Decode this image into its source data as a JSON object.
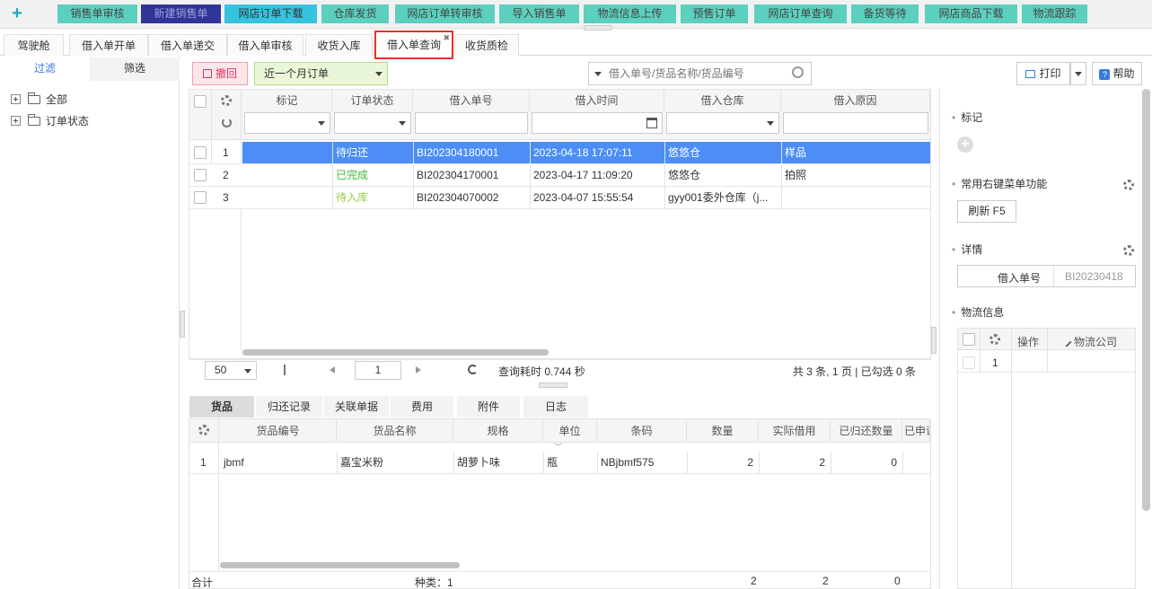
{
  "toolbar": {
    "add_icon": "plus-icon",
    "buttons": [
      {
        "label": "销售单审核",
        "style": "teal"
      },
      {
        "label": "新建销售单",
        "style": "navy"
      },
      {
        "label": "网店订单下载",
        "style": "cyan"
      },
      {
        "label": "仓库发货",
        "style": "teal"
      },
      {
        "label": "网店订单转审核",
        "style": "teal"
      },
      {
        "label": "导入销售单",
        "style": "teal"
      },
      {
        "label": "物流信息上传",
        "style": "teal"
      },
      {
        "label": "预售订单",
        "style": "teal"
      },
      {
        "label": "网店订单查询",
        "style": "teal"
      },
      {
        "label": "备货等待",
        "style": "teal"
      },
      {
        "label": "网店商品下载",
        "style": "teal"
      },
      {
        "label": "物流跟踪",
        "style": "teal"
      }
    ]
  },
  "tabs": [
    {
      "label": "驾驶舱"
    },
    {
      "label": "借入单开单"
    },
    {
      "label": "借入单递交"
    },
    {
      "label": "借入单审核"
    },
    {
      "label": "收货入库"
    },
    {
      "label": "借入单查询",
      "active": true
    },
    {
      "label": "收货质检"
    }
  ],
  "left": {
    "tabs": [
      "过滤",
      "筛选"
    ],
    "tree": [
      "全部",
      "订单状态"
    ]
  },
  "actions": {
    "revoke": "撤回",
    "date_filter": "近一个月订单",
    "search_placeholder": "借入单号/货品名称/货品编号",
    "print": "打印",
    "help": "帮助"
  },
  "grid": {
    "columns": [
      "标记",
      "订单状态",
      "借入单号",
      "借入时间",
      "借入仓库",
      "借入原因"
    ],
    "rows": [
      {
        "no": "1",
        "status": "待归还",
        "status_color": "#ffffff",
        "id": "BI202304180001",
        "time": "2023-04-18 17:07:11",
        "wh": "悠悠仓",
        "reason": "样品",
        "selected": true
      },
      {
        "no": "2",
        "status": "已完成",
        "status_color": "#3cb93c",
        "id": "BI202304170001",
        "time": "2023-04-17 11:09:20",
        "wh": "悠悠仓",
        "reason": "拍照",
        "selected": false
      },
      {
        "no": "3",
        "status": "待入库",
        "status_color": "#9ccc4a",
        "id": "BI202304070002",
        "time": "2023-04-07 15:55:54",
        "wh": "gyy001委外仓库（j...",
        "reason": "",
        "selected": false
      }
    ],
    "pager": {
      "page_size": "50",
      "page": "1",
      "elapsed": "查询耗时 0.744 秒",
      "summary": "共 3 条, 1 页 | 已勾选 0 条"
    }
  },
  "bottom": {
    "tabs": [
      "货品",
      "归还记录",
      "关联单据",
      "费用",
      "附件",
      "日志"
    ],
    "columns": [
      "货品编号",
      "货品名称",
      "规格",
      "单位",
      "条码",
      "数量",
      "实际借用",
      "已归还数量",
      "已申请"
    ],
    "rows": [
      {
        "no": "1",
        "code": "jbmf",
        "name": "嘉宝米粉",
        "spec": "胡萝卜味",
        "unit": "瓶",
        "barcode": "NBjbmf575",
        "qty": "2",
        "actual": "2",
        "returned": "0"
      }
    ],
    "footer": {
      "total": "合计",
      "kinds": "种类：1",
      "qty": "2",
      "actual": "2",
      "returned": "0"
    }
  },
  "right": {
    "mark_title": "标记",
    "menu_title": "常用右键菜单功能",
    "refresh_btn": "刷新  F5",
    "detail_title": "详情",
    "detail_label": "借入单号",
    "detail_value": "BI20230418",
    "logistics_title": "物流信息",
    "logistics_cols": [
      "操作",
      "物流公司"
    ],
    "logistics_row": "1"
  }
}
